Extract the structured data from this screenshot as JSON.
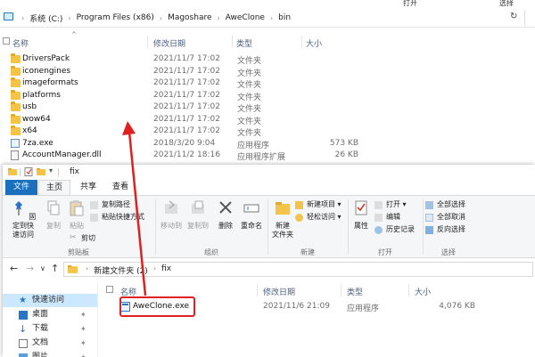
{
  "bg_window": {
    "ribbon_fragments": [
      "",
      "打开",
      "选择"
    ],
    "breadcrumbs": [
      "系统 (C:)",
      "Program Files (x86)",
      "Magoshare",
      "AweClone",
      "bin"
    ],
    "columns": {
      "name": "名称",
      "date": "修改日期",
      "type": "类型",
      "size": "大小"
    },
    "rows": [
      {
        "name": "DriversPack",
        "date": "2021/11/7 17:02",
        "type": "文件夹",
        "size": "",
        "icon": "folder-icon"
      },
      {
        "name": "iconengines",
        "date": "2021/11/7 17:02",
        "type": "文件夹",
        "size": "",
        "icon": "folder-icon"
      },
      {
        "name": "imageformats",
        "date": "2021/11/7 17:02",
        "type": "文件夹",
        "size": "",
        "icon": "folder-icon"
      },
      {
        "name": "platforms",
        "date": "2021/11/7 17:02",
        "type": "文件夹",
        "size": "",
        "icon": "folder-icon"
      },
      {
        "name": "usb",
        "date": "2021/11/7 17:02",
        "type": "文件夹",
        "size": "",
        "icon": "folder-icon"
      },
      {
        "name": "wow64",
        "date": "2021/11/7 17:02",
        "type": "文件夹",
        "size": "",
        "icon": "folder-icon"
      },
      {
        "name": "x64",
        "date": "2021/11/7 17:02",
        "type": "文件夹",
        "size": "",
        "icon": "folder-icon"
      },
      {
        "name": "7za.exe",
        "date": "2018/3/20 9:04",
        "type": "应用程序",
        "size": "573 KB",
        "icon": "exe-icon"
      },
      {
        "name": "AccountManager.dll",
        "date": "2021/11/2 18:16",
        "type": "应用程序扩展",
        "size": "26 KB",
        "icon": "dll-icon"
      }
    ]
  },
  "fg_window": {
    "title": "fix",
    "tabs": {
      "file": "文件",
      "home": "主页",
      "share": "共享",
      "view": "查看"
    },
    "clipboard": {
      "pin": "固定到快\n速访问",
      "copy": "复制",
      "paste": "粘贴",
      "cut": "剪切",
      "copy_path": "复制路径",
      "paste_shortcut": "粘贴快捷方式",
      "label": "剪贴板"
    },
    "organize": {
      "move_to": "移动到",
      "copy_to": "复制到",
      "delete": "删除",
      "rename": "重命名",
      "label": "组织"
    },
    "new": {
      "new_folder": "新建\n文件夹",
      "new_item": "新建项目 ▾",
      "easy_access": "轻松访问 ▾",
      "label": "新建"
    },
    "open": {
      "properties": "属性",
      "open": "打开 ▾",
      "edit": "编辑",
      "history": "历史记录",
      "label": "打开"
    },
    "select": {
      "select_all": "全部选择",
      "select_none": "全部取消",
      "invert": "反向选择",
      "label": "选择"
    },
    "breadcrumbs": [
      "新建文件夹 (2)",
      "fix"
    ],
    "nav_arrows": [
      "←",
      "→",
      "∨",
      "↑"
    ],
    "sidebar": [
      {
        "label": "快速访问",
        "icon": "star-icon",
        "pinned": false
      },
      {
        "label": "桌面",
        "icon": "desktop-icon",
        "pinned": true
      },
      {
        "label": "下载",
        "icon": "download-icon",
        "pinned": true
      },
      {
        "label": "文档",
        "icon": "document-icon",
        "pinned": true
      },
      {
        "label": "图片",
        "icon": "picture-icon",
        "pinned": true
      }
    ],
    "pin_glyph": "✦",
    "columns": {
      "name": "名称",
      "date": "修改日期",
      "type": "类型",
      "size": "大小"
    },
    "file": {
      "name": "AweClone.exe",
      "date": "2021/11/6 21:09",
      "type": "应用程序",
      "size": "4,076 KB"
    }
  },
  "colors": {
    "accent": "#1a6fbf",
    "highlight_box": "#e02020",
    "arrow": "#e02020",
    "folder": "#f4c44a"
  }
}
